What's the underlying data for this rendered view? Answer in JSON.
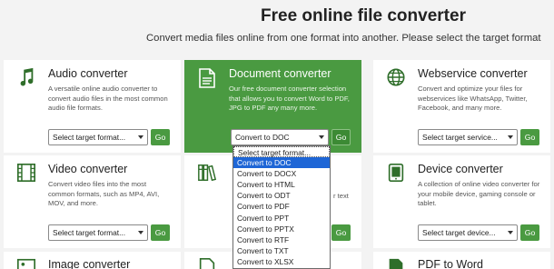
{
  "header": {
    "title": "Free online file converter",
    "subtitle": "Convert media files online from one format into another. Please select the target format"
  },
  "cards": {
    "audio": {
      "title": "Audio converter",
      "desc": "A versatile online audio converter to convert audio files in the most common audio file formats.",
      "select": "Select target format...",
      "go": "Go"
    },
    "document": {
      "title": "Document converter",
      "desc": "Our free document converter selection that allows you to convert Word to PDF, JPG to PDF any many more.",
      "select": "Convert to DOC",
      "go": "Go"
    },
    "webservice": {
      "title": "Webservice converter",
      "desc": "Convert and optimize your files for webservices like WhatsApp, Twitter, Facebook, and many more.",
      "select": "Select target service...",
      "go": "Go"
    },
    "video": {
      "title": "Video converter",
      "desc": "Convert video files into the most common formats, such as MP4, AVI, MOV, and more.",
      "select": "Select target format...",
      "go": "Go"
    },
    "ebook": {
      "desc_tail": "r text",
      "go": "Go"
    },
    "device": {
      "title": "Device converter",
      "desc": "A collection of online video converter for your mobile device, gaming console or tablet.",
      "select": "Select target device...",
      "go": "Go"
    },
    "image": {
      "title": "Image converter"
    },
    "pdf": {
      "title": "PDF to Word"
    }
  },
  "dropdown": {
    "options": [
      "Select target format...",
      "Convert to DOC",
      "Convert to DOCX",
      "Convert to HTML",
      "Convert to ODT",
      "Convert to PDF",
      "Convert to PPT",
      "Convert to PPTX",
      "Convert to RTF",
      "Convert to TXT",
      "Convert to XLSX"
    ],
    "selected_index": 1
  },
  "colors": {
    "brand_green": "#4a9a41",
    "page_bg": "#f3f3f3",
    "highlight_blue": "#1e66d6"
  }
}
